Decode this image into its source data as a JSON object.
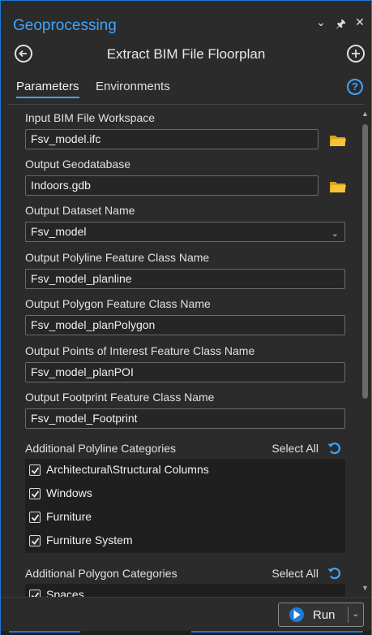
{
  "pane": {
    "title": "Geoprocessing"
  },
  "tool": {
    "title": "Extract BIM File Floorplan"
  },
  "tabs": {
    "parameters": "Parameters",
    "environments": "Environments"
  },
  "params": [
    {
      "label": "Input BIM File Workspace",
      "value": "Fsv_model.ifc",
      "kind": "file"
    },
    {
      "label": "Output Geodatabase",
      "value": "Indoors.gdb",
      "kind": "file"
    },
    {
      "label": "Output Dataset Name",
      "value": "Fsv_model",
      "kind": "dropdown"
    },
    {
      "label": "Output Polyline Feature Class Name",
      "value": "Fsv_model_planline",
      "kind": "text"
    },
    {
      "label": "Output Polygon Feature Class Name",
      "value": "Fsv_model_planPolygon",
      "kind": "text"
    },
    {
      "label": "Output Points of Interest Feature Class Name",
      "value": "Fsv_model_planPOI",
      "kind": "text"
    },
    {
      "label": "Output Footprint Feature Class Name",
      "value": "Fsv_model_Footprint",
      "kind": "text"
    }
  ],
  "polyline_categories": {
    "label": "Additional Polyline Categories",
    "select_all": "Select All",
    "items": [
      {
        "label": "Architectural\\Structural Columns",
        "checked": true
      },
      {
        "label": "Windows",
        "checked": true
      },
      {
        "label": "Furniture",
        "checked": true
      },
      {
        "label": "Furniture System",
        "checked": true
      }
    ]
  },
  "polygon_categories": {
    "label": "Additional Polygon Categories",
    "select_all": "Select All",
    "items": [
      {
        "label": "Spaces",
        "checked": true
      }
    ]
  },
  "run": {
    "label": "Run"
  },
  "colors": {
    "accent": "#3ea6ff",
    "background": "#2b2b2b",
    "folder": "#e8b520"
  }
}
